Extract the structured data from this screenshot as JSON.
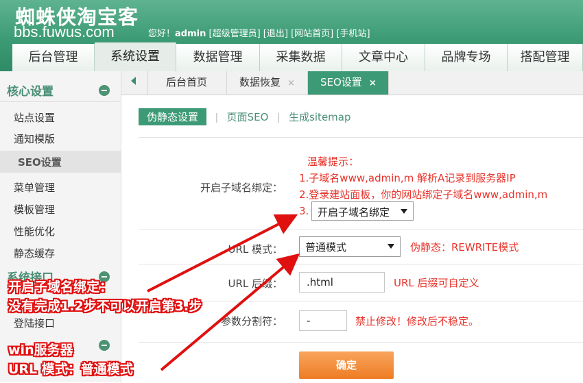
{
  "header": {
    "site_name": "蜘蛛侠淘宝客",
    "site_url": "bbs.fuwus.com",
    "greeting": "您好！",
    "username": "admin",
    "role": "[超级管理员]",
    "logout": "[退出]",
    "site_home": "[网站首页]",
    "mobile_site": "[手机站]"
  },
  "main_nav": [
    {
      "label": "后台管理"
    },
    {
      "label": "系统设置"
    },
    {
      "label": "数据管理"
    },
    {
      "label": "采集数据"
    },
    {
      "label": "文章中心"
    },
    {
      "label": "品牌专场"
    },
    {
      "label": "搭配管理"
    }
  ],
  "sidebar": {
    "section1_title": "核心设置",
    "items": [
      "站点设置",
      "通知模版",
      "SEO设置",
      "菜单管理",
      "模板管理",
      "性能优化",
      "静态缓存"
    ],
    "section2_title": "系统接口",
    "section2_items": [
      "登陆接口"
    ]
  },
  "content_tabs": [
    {
      "label": "后台首页",
      "close": ""
    },
    {
      "label": "数据恢复",
      "close": "×"
    },
    {
      "label": "SEO设置",
      "close": "×"
    }
  ],
  "subtabs": {
    "active": "伪静态设置",
    "links": [
      "页面SEO",
      "生成sitemap"
    ],
    "separator": "|"
  },
  "form": {
    "subdomain": {
      "label": "开启子域名绑定：",
      "tip_title": "温馨提示：",
      "tip_1": "1.子域名www,admin,m 解析A记录到服务器IP",
      "tip_2": "2.登录建站面板，你的网站绑定子域名www,admin,m",
      "tip_3_prefix": "3.",
      "select_value": "开启子域名绑定"
    },
    "url_mode": {
      "label": "URL 模式：",
      "select_value": "普通模式",
      "note": "伪静态：REWRITE模式"
    },
    "url_suffix": {
      "label": "URL 后缀：",
      "value": ".html",
      "note": "URL 后缀可自定义"
    },
    "param_sep": {
      "label": "参数分割符：",
      "value": "-",
      "note": "禁止修改！修改后不稳定。"
    },
    "submit": "确定"
  },
  "annotations": {
    "note1_line1": "开启子域名绑定：",
    "note1_line2": "没有完成1.2步不可以开启第3.步",
    "note2_line1": "win服务器",
    "note2_line2": "URL 模式：普通模式"
  },
  "colors": {
    "brand_green": "#3d9a77",
    "tip_red": "#e8332a",
    "submit_orange": "#ee7d25",
    "annotation_red": "#e01010"
  }
}
